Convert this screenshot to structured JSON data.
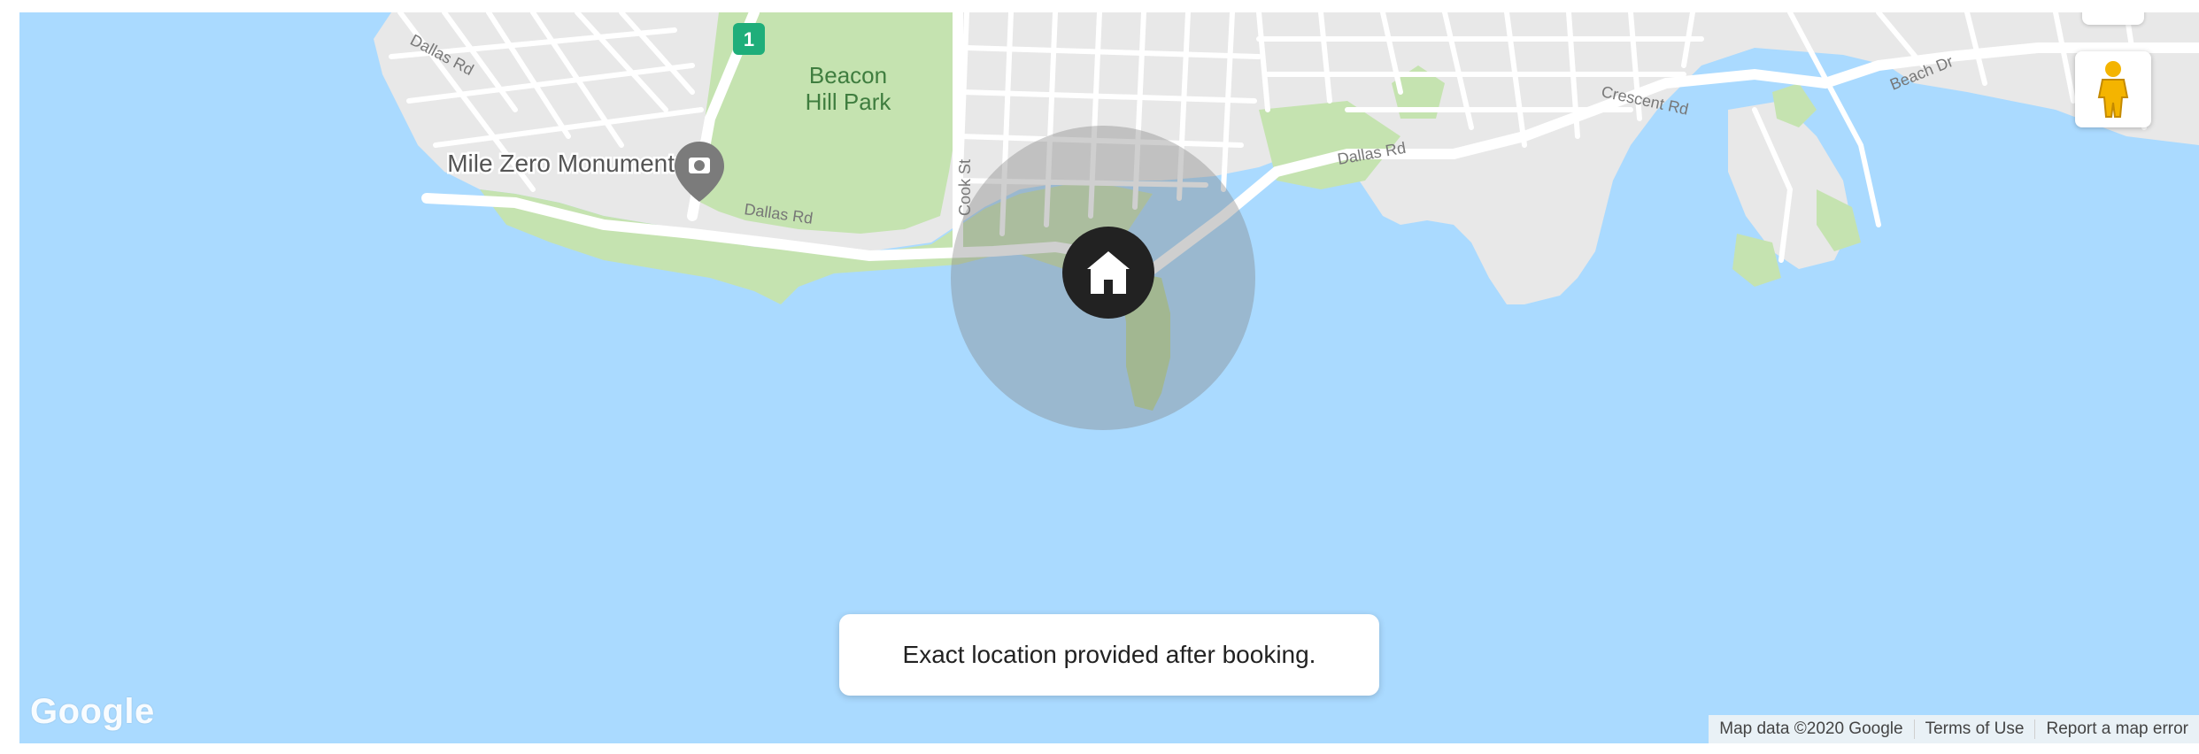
{
  "map": {
    "place_labels": {
      "park_line1": "Beacon",
      "park_line2": "Hill Park",
      "monument": "Mile Zero Monument"
    },
    "street_labels": {
      "dallas_rd_top": "Dallas Rd",
      "dallas_rd_mid": "Dallas Rd",
      "dallas_rd_east": "Dallas Rd",
      "cook_st": "Cook St",
      "crescent_rd": "Crescent Rd",
      "beach_dr": "Beach Dr"
    },
    "highway_shield": "1",
    "location_notice": "Exact location provided after booking.",
    "logo_text": "Google",
    "attribution": {
      "map_data": "Map data ©2020 Google",
      "terms": "Terms of Use",
      "report": "Report a map error"
    },
    "colors": {
      "water": "#aadaff",
      "land": "#e8e8e8",
      "park": "#c5e3b0",
      "road": "#ffffff",
      "approx_circle": "#808080",
      "home_marker": "#222222"
    },
    "icons": {
      "home_marker": "home-icon",
      "monument_marker": "camera-icon",
      "street_view": "pegman-icon"
    }
  }
}
